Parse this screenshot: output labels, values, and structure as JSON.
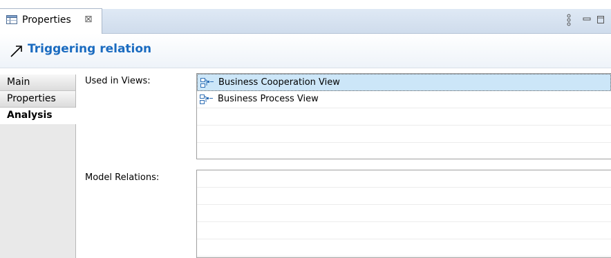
{
  "tab": {
    "label": "Properties",
    "close": "⊠"
  },
  "header": {
    "title": "Triggering relation",
    "icon": "triggering-relation-icon"
  },
  "nav": {
    "items": [
      {
        "label": "Main",
        "active": false
      },
      {
        "label": "Properties",
        "active": false
      },
      {
        "label": "Analysis",
        "active": true
      }
    ]
  },
  "analysis": {
    "used_in_views_label": "Used in Views:",
    "views": [
      {
        "label": "Business Cooperation View",
        "selected": true,
        "icon": "view-icon"
      },
      {
        "label": "Business Process View",
        "selected": false,
        "icon": "view-icon"
      }
    ],
    "model_relations_label": "Model Relations:",
    "relations": []
  },
  "colors": {
    "accent": "#1a6bc0",
    "selection": "#cce6f8",
    "tab_strip": "#dfe9f5"
  }
}
